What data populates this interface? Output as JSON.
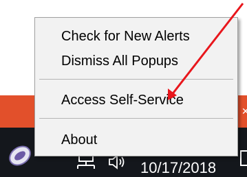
{
  "context_menu": {
    "items": [
      {
        "label": "Check for New Alerts"
      },
      {
        "label": "Dismiss All Popups"
      },
      {
        "label": "Access Self-Service"
      },
      {
        "label": "About"
      }
    ]
  },
  "taskbar": {
    "clock_date": "10/17/2018",
    "background_color": "#14171c"
  },
  "colors": {
    "menu_background": "#f2f2f2",
    "annotation_arrow": "#e8161c",
    "app_banner": "#e2502b"
  },
  "icons": [
    "app-icon",
    "network-icon",
    "volume-icon"
  ]
}
